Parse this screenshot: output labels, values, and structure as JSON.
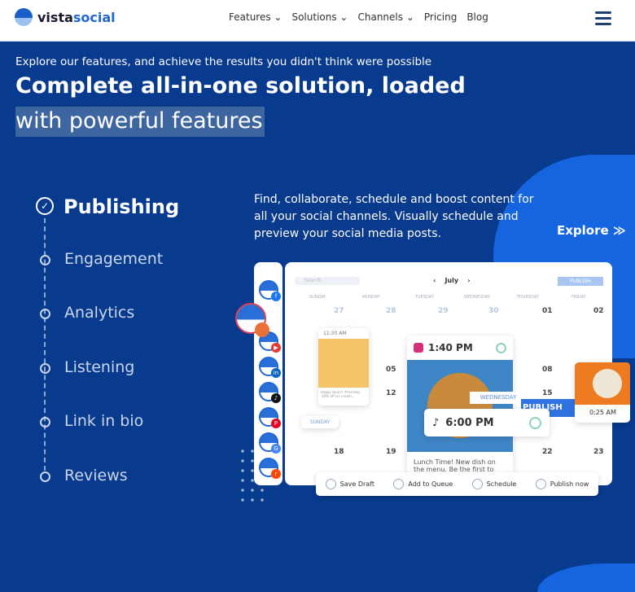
{
  "nav": {
    "brand_a": "vista",
    "brand_b": "social",
    "items": [
      "Features ⌄",
      "Solutions ⌄",
      "Channels ⌄",
      "Pricing",
      "Blog"
    ]
  },
  "hero": {
    "subtitle": "Explore our features, and achieve the results you didn't think were possible",
    "title_line1": "Complete all-in-one solution, loaded",
    "title_line2": "with powerful features"
  },
  "features": [
    "Publishing",
    "Engagement",
    "Analytics",
    "Listening",
    "Link in bio",
    "Reviews"
  ],
  "active_feature": "Publishing",
  "description": "Find, collaborate, schedule and boost content for all your social channels. Visually schedule and preview your social media posts.",
  "explore_label": "Explore ≫",
  "mockup": {
    "month": "July",
    "publish_btn": "PUBLISH",
    "search": "Search",
    "weekdays": [
      "SUNDAY",
      "MONDAY",
      "TUESDAY",
      "WEDNESDAY",
      "THURSDAY",
      "FRIDAY"
    ],
    "days": [
      "27",
      "28",
      "29",
      "30",
      "01",
      "02",
      "05",
      "08",
      "12",
      "15",
      "18",
      "19",
      "22",
      "23"
    ],
    "post1_time": "11:30 AM",
    "post1_text": "Happy Hours! #monday -20% off ice cream...",
    "post2_time": "1:40 PM",
    "post2_text": "Lunch Time! New dish on the menu. Be the first to",
    "post3_time": "6:00 PM",
    "wednesday": "WEDNESDAY",
    "sunday": "SUNDAY",
    "publish_banner": "PUBLISH",
    "post4_time": "0:25 AM",
    "actions": [
      "Save Draft",
      "Add to Queue",
      "Schedule",
      "Publish now"
    ]
  },
  "colors": {
    "bg": "#083a8e",
    "accent": "#1565e0"
  }
}
